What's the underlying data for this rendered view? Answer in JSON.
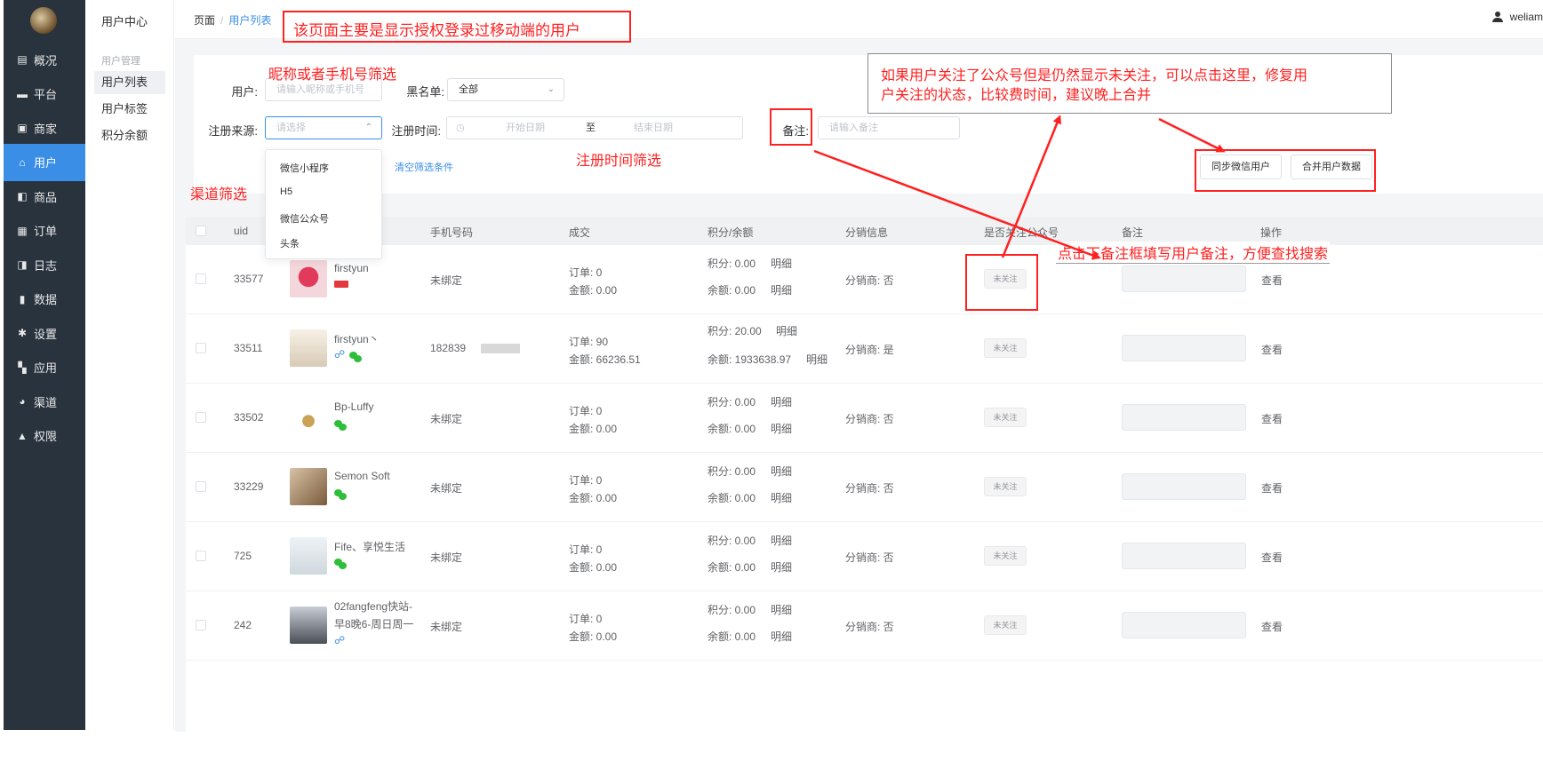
{
  "sidebar": {
    "items": [
      {
        "label": "概况",
        "icon": "monitor-icon"
      },
      {
        "label": "平台",
        "icon": "platform-icon"
      },
      {
        "label": "商家",
        "icon": "store-icon"
      },
      {
        "label": "用户",
        "icon": "user-icon",
        "active": true
      },
      {
        "label": "商品",
        "icon": "product-icon"
      },
      {
        "label": "订单",
        "icon": "order-icon"
      },
      {
        "label": "日志",
        "icon": "log-icon"
      },
      {
        "label": "数据",
        "icon": "chart-icon"
      },
      {
        "label": "设置",
        "icon": "gear-icon"
      },
      {
        "label": "应用",
        "icon": "apps-icon"
      },
      {
        "label": "渠道",
        "icon": "channel-icon"
      },
      {
        "label": "权限",
        "icon": "lock-icon"
      }
    ]
  },
  "submenu": {
    "title": "用户中心",
    "group": "用户管理",
    "items": [
      {
        "label": "用户列表",
        "active": true
      },
      {
        "label": "用户标签"
      },
      {
        "label": "积分余额"
      }
    ]
  },
  "header": {
    "breadcrumb": {
      "root": "页面",
      "sep": "/",
      "current": "用户列表"
    },
    "username": "weliam"
  },
  "filter": {
    "user_label": "用户:",
    "user_placeholder": "请输入昵称或手机号",
    "blacklist_label": "黑名单:",
    "blacklist_value": "全部",
    "source_label": "注册来源:",
    "source_placeholder": "请选择",
    "time_label": "注册时间:",
    "start_placeholder": "开始日期",
    "range_sep": "至",
    "end_placeholder": "结束日期",
    "remark_label": "备注:",
    "remark_placeholder": "请输入备注",
    "clear_link": "清空筛选条件",
    "sync_button": "同步微信用户",
    "merge_button": "合并用户数据"
  },
  "dropdown": {
    "options": [
      "微信小程序",
      "H5",
      "微信公众号",
      "头条"
    ]
  },
  "table": {
    "headers": [
      "uid",
      "手机号码",
      "成交",
      "积分/余额",
      "分销信息",
      "是否关注公众号",
      "备注",
      "操作"
    ],
    "rows": [
      {
        "uid": "33577",
        "nick": "firstyun",
        "phone": "未绑定",
        "orders": "订单: 0",
        "amount": "金额: 0.00",
        "points": "积分: 0.00",
        "balance": "余额: 0.00",
        "detail": "明细",
        "dist": "分销商: 否",
        "follow": "未关注",
        "action": "查看"
      },
      {
        "uid": "33511",
        "nick": "firstyun丶",
        "phone": "182839",
        "orders": "订单: 90",
        "amount": "金额: 66236.51",
        "points": "积分: 20.00",
        "balance": "余额: 1933638.97",
        "detail": "明细",
        "dist": "分销商: 是",
        "follow": "未关注",
        "action": "查看"
      },
      {
        "uid": "33502",
        "nick": "Bp-Luffy",
        "phone": "未绑定",
        "orders": "订单: 0",
        "amount": "金额: 0.00",
        "points": "积分: 0.00",
        "balance": "余额: 0.00",
        "detail": "明细",
        "dist": "分销商: 否",
        "follow": "未关注",
        "action": "查看"
      },
      {
        "uid": "33229",
        "nick": "Semon Soft",
        "phone": "未绑定",
        "orders": "订单: 0",
        "amount": "金额: 0.00",
        "points": "积分: 0.00",
        "balance": "余额: 0.00",
        "detail": "明细",
        "dist": "分销商: 否",
        "follow": "未关注",
        "action": "查看"
      },
      {
        "uid": "725",
        "nick": "Fife、享悦生活",
        "phone": "未绑定",
        "orders": "订单: 0",
        "amount": "金额: 0.00",
        "points": "积分: 0.00",
        "balance": "余额: 0.00",
        "detail": "明细",
        "dist": "分销商: 否",
        "follow": "未关注",
        "action": "查看"
      },
      {
        "uid": "242",
        "nick": "02fangfeng快站-",
        "nick2": "早8晚6-周日周一",
        "phone": "未绑定",
        "orders": "订单: 0",
        "amount": "金额: 0.00",
        "points": "积分: 0.00",
        "balance": "余额: 0.00",
        "detail": "明细",
        "dist": "分销商: 否",
        "follow": "未关注",
        "action": "查看"
      }
    ]
  },
  "annotations": {
    "page_purpose": "该页面主要是显示授权登录过移动端的用户",
    "nick_phone_filter": "昵称或者手机号筛选",
    "reg_time_filter": "注册时间筛选",
    "channel_filter": "渠道筛选",
    "remark_tip": "点击下备注框填写用户备注，方便查找搜索",
    "follow_tip_line1": "如果用户关注了公众号但是仍然显示未关注，可以点击这里，修复用",
    "follow_tip_line2": "户关注的状态，比较费时间，建议晚上合并"
  },
  "colors": {
    "accent": "#3a8ee6",
    "sidebar": "#28333e",
    "annotation": "#ff2020",
    "wechat": "#2dbe3a"
  }
}
